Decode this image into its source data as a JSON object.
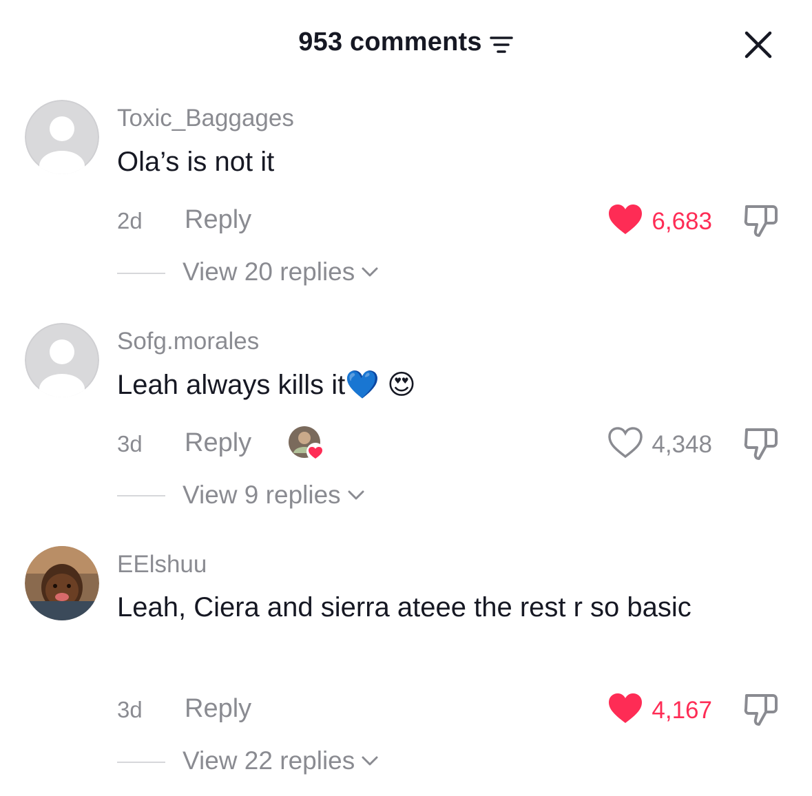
{
  "header": {
    "title": "953 comments"
  },
  "comments": [
    {
      "username": "Toxic_Baggages",
      "text": "Ola’s is not it",
      "time": "2d",
      "reply_label": "Reply",
      "likes": "6,683",
      "liked": true,
      "view_replies": "View 20 replies"
    },
    {
      "username": "Sofg.morales",
      "text": "Leah always kills it💙 😍",
      "time": "3d",
      "reply_label": "Reply",
      "likes": "4,348",
      "liked": false,
      "view_replies": "View 9 replies"
    },
    {
      "username": "EElshuu",
      "text": "Leah, Ciera and sierra ateee the rest r so basic",
      "time": "3d",
      "reply_label": "Reply",
      "likes": "4,167",
      "liked": true,
      "view_replies": "View 22 replies"
    }
  ],
  "colors": {
    "like_red": "#fe2c55",
    "muted_gray": "#8a8b91",
    "text_dark": "#161823"
  }
}
